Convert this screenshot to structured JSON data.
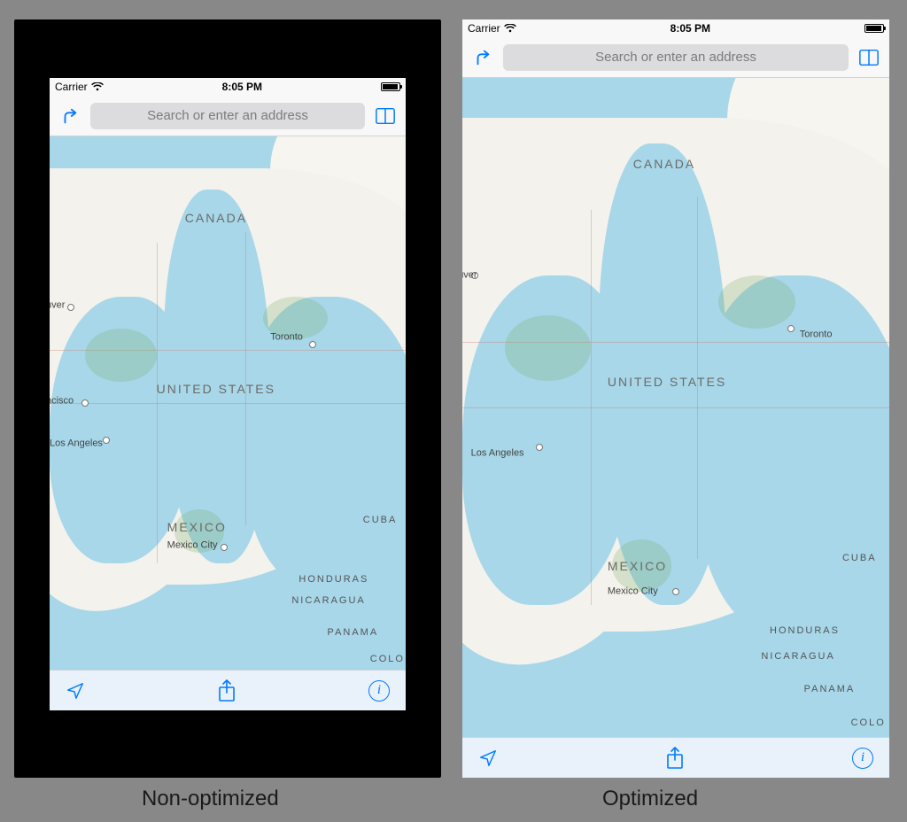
{
  "comparison": {
    "left_caption": "Non-optimized",
    "right_caption": "Optimized"
  },
  "status": {
    "carrier": "Carrier",
    "time": "8:05 PM"
  },
  "nav": {
    "search_placeholder": "Search or enter an address"
  },
  "map": {
    "countries": {
      "canada": "CANADA",
      "usa": "UNITED STATES",
      "mexico": "MEXICO",
      "cuba": "CUBA",
      "honduras": "HONDURAS",
      "nicaragua": "NICARAGUA",
      "panama": "PANAMA",
      "colo": "COLO"
    },
    "cities": {
      "toronto": "Toronto",
      "la": "Los Angeles",
      "mexcity": "Mexico City",
      "sf_frag": "ncisco",
      "van_frag": "uver"
    }
  }
}
